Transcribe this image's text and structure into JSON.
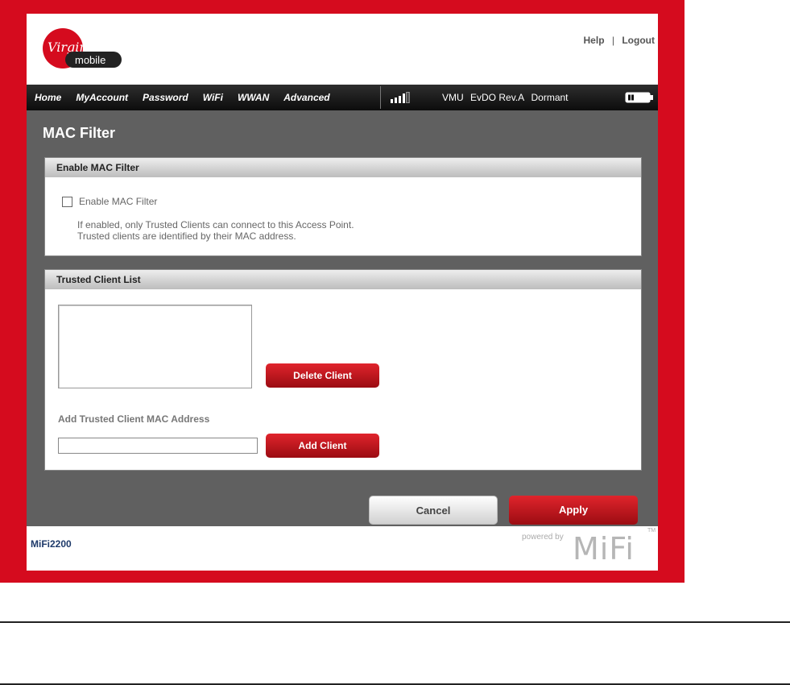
{
  "header": {
    "brand_top": "Virgin",
    "brand_bottom": "mobile",
    "links": {
      "help": "Help",
      "separator": "|",
      "logout": "Logout"
    }
  },
  "nav": {
    "items": [
      "Home",
      "MyAccount",
      "Password",
      "WiFi",
      "WWAN",
      "Advanced"
    ],
    "status": {
      "carrier": "VMU",
      "network": "EvDO Rev.A",
      "state": "Dormant"
    }
  },
  "page": {
    "title": "MAC Filter",
    "mac_section": {
      "header": "Enable MAC Filter",
      "checkbox_label": "Enable MAC Filter",
      "checked": false,
      "desc_line1": "If enabled, only Trusted Clients can connect to this Access Point.",
      "desc_line2": "Trusted clients are identified by their MAC address."
    },
    "trusted_section": {
      "header": "Trusted Client List",
      "clients": [],
      "delete_button": "Delete Client",
      "add_label": "Add Trusted Client MAC Address",
      "add_input_value": "",
      "add_button": "Add Client"
    },
    "cancel_button": "Cancel",
    "apply_button": "Apply"
  },
  "footer": {
    "model": "MiFi2200",
    "powered_by": "powered by",
    "mifi_logo": "MiFi",
    "tm": "TM"
  },
  "colors": {
    "brand_red": "#d50b1e",
    "nav_bg": "#111111",
    "content_grey": "#606060",
    "button_red": "#c4141c",
    "model_text": "#1e3a6a"
  },
  "icons": [
    "signal-strength-icon",
    "battery-icon",
    "checkbox-icon"
  ]
}
